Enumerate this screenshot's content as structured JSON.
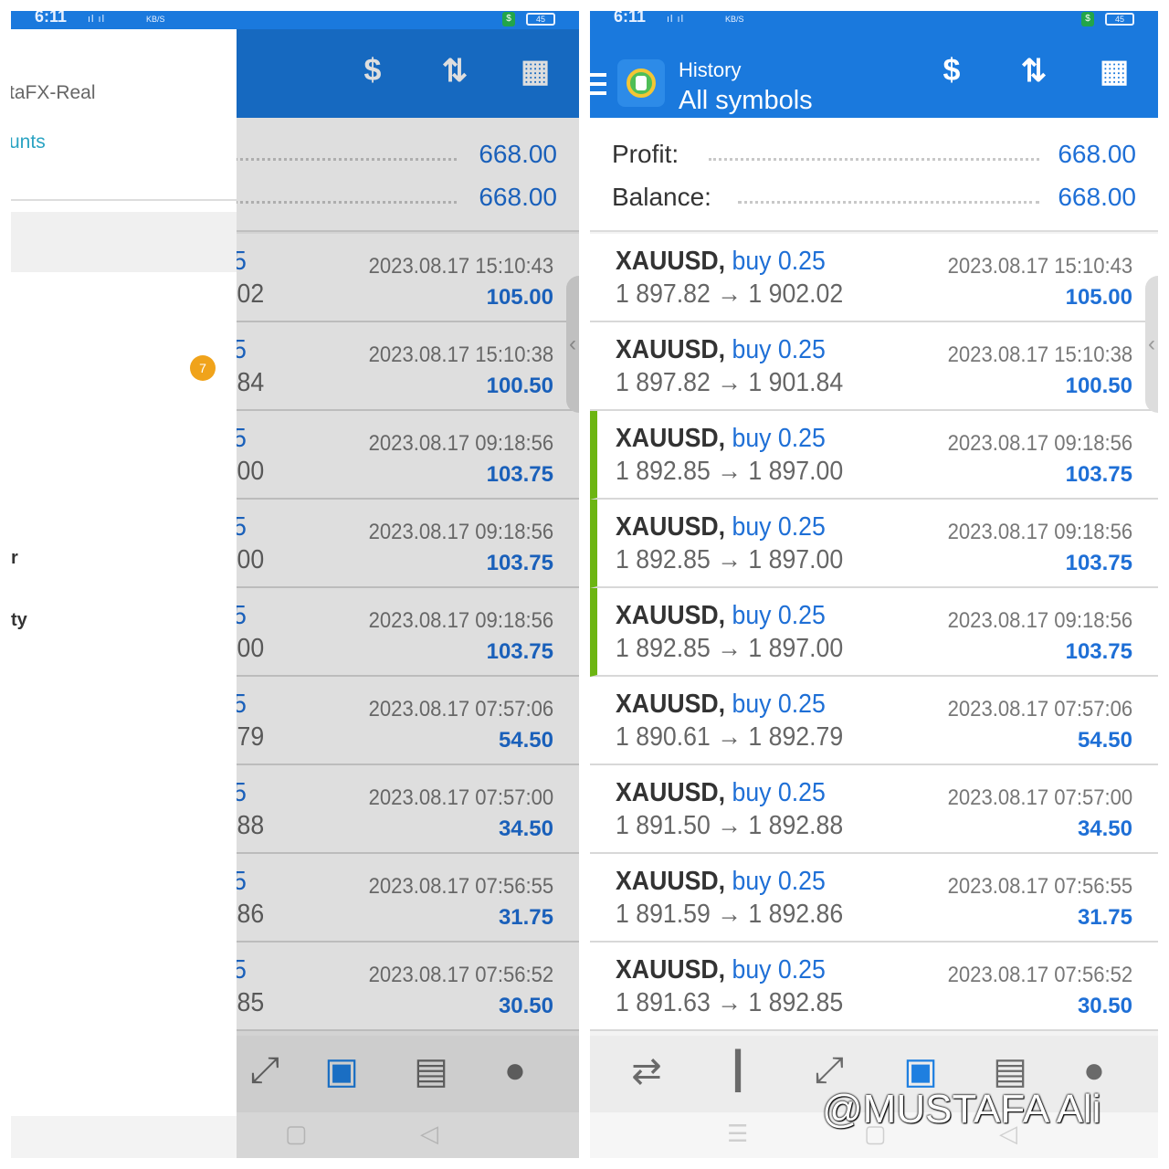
{
  "status": {
    "time": "6:11",
    "signal": "ıl ıl",
    "kbs": "KB/S",
    "battery": "45",
    "shield": "$"
  },
  "header": {
    "title": "History",
    "subtitle": "All symbols"
  },
  "toolbar": {
    "deposit_icon": "dollar-exchange-icon",
    "sort_icon": "sort-icon",
    "calendar_icon": "calendar-icon"
  },
  "summary": {
    "profit_label": "Profit:",
    "profit_value": "668.00",
    "balance_label": "Balance:",
    "balance_value": "668.00"
  },
  "trades": [
    {
      "symbol": "XAUUSD,",
      "type": "buy 0.25",
      "prices": "1 897.82 → 1 902.02",
      "time": "2023.08.17 15:10:43",
      "profit": "105.00",
      "frag": "02",
      "highlight": false
    },
    {
      "symbol": "XAUUSD,",
      "type": "buy 0.25",
      "prices": "1 897.82 → 1 901.84",
      "time": "2023.08.17 15:10:38",
      "profit": "100.50",
      "frag": "84",
      "highlight": false
    },
    {
      "symbol": "XAUUSD,",
      "type": "buy 0.25",
      "prices": "1 892.85 → 1 897.00",
      "time": "2023.08.17 09:18:56",
      "profit": "103.75",
      "frag": "00",
      "highlight": true
    },
    {
      "symbol": "XAUUSD,",
      "type": "buy 0.25",
      "prices": "1 892.85 → 1 897.00",
      "time": "2023.08.17 09:18:56",
      "profit": "103.75",
      "frag": "00",
      "highlight": true
    },
    {
      "symbol": "XAUUSD,",
      "type": "buy 0.25",
      "prices": "1 892.85 → 1 897.00",
      "time": "2023.08.17 09:18:56",
      "profit": "103.75",
      "frag": "00",
      "highlight": true
    },
    {
      "symbol": "XAUUSD,",
      "type": "buy 0.25",
      "prices": "1 890.61 → 1 892.79",
      "time": "2023.08.17 07:57:06",
      "profit": "54.50",
      "frag": "79",
      "highlight": false
    },
    {
      "symbol": "XAUUSD,",
      "type": "buy 0.25",
      "prices": "1 891.50 → 1 892.88",
      "time": "2023.08.17 07:57:00",
      "profit": "34.50",
      "frag": "88",
      "highlight": false
    },
    {
      "symbol": "XAUUSD,",
      "type": "buy 0.25",
      "prices": "1 891.59 → 1 892.86",
      "time": "2023.08.17 07:56:55",
      "profit": "31.75",
      "frag": "86",
      "highlight": false
    },
    {
      "symbol": "XAUUSD,",
      "type": "buy 0.25",
      "prices": "1 891.63 → 1 892.85",
      "time": "2023.08.17 07:56:52",
      "profit": "30.50",
      "frag": "85",
      "highlight": false
    }
  ],
  "drawer": {
    "account": "taFX-Real",
    "manage": "unts",
    "badge": "7",
    "frag1": "r",
    "frag2": "ty"
  },
  "bottom_nav": [
    "quotes-icon",
    "chart-icon",
    "trade-icon",
    "history-icon",
    "news-icon",
    "chat-icon"
  ],
  "watermark": "@MUSTAFA Ali",
  "colors": {
    "accent": "#1a79dd",
    "value_blue": "#1e6fd6",
    "highlight_green": "#6cb512",
    "badge_orange": "#f0a31b"
  }
}
